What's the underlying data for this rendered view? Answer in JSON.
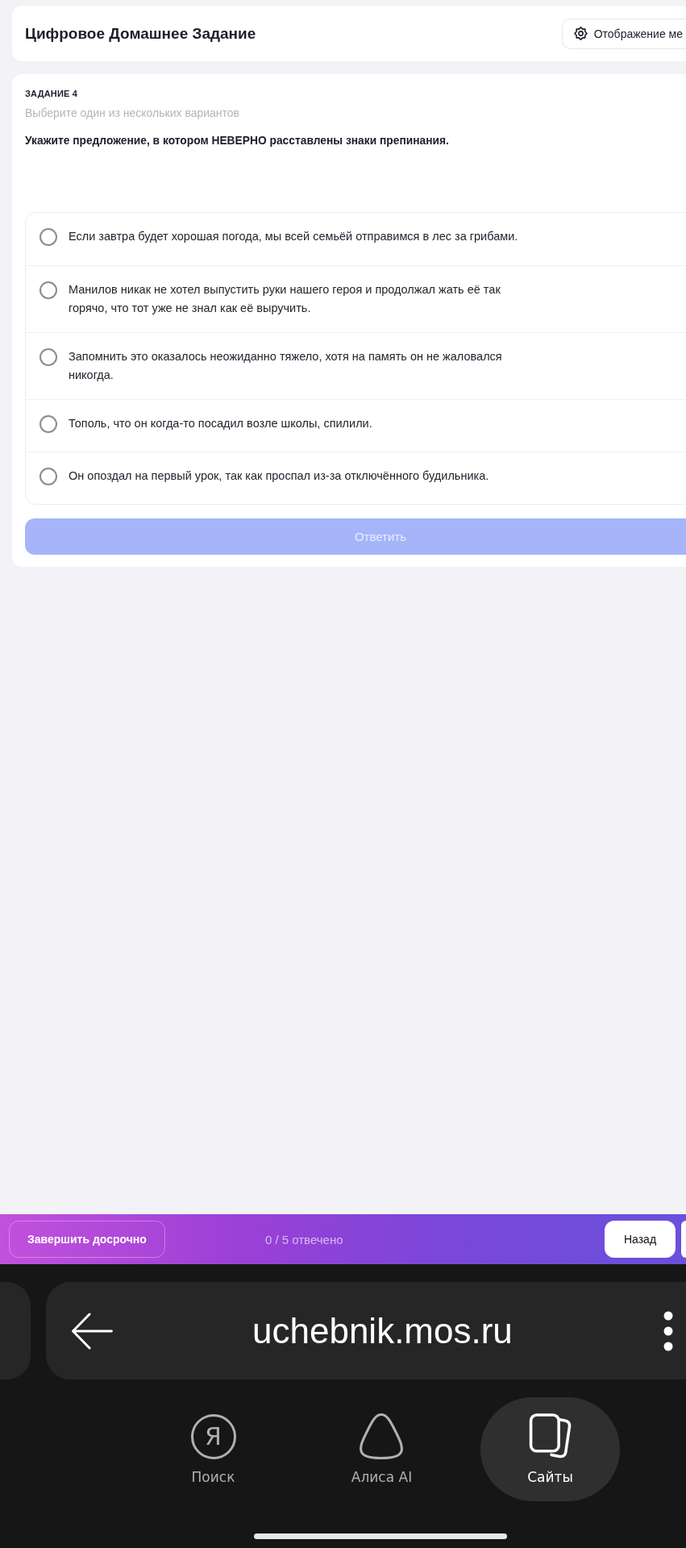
{
  "header": {
    "title": "Цифровое Домашнее Задание",
    "display_button": "Отображение ме"
  },
  "task": {
    "label": "ЗАДАНИЕ 4",
    "hint": "Выберите один из нескольких вариантов",
    "question": "Укажите предложение, в котором НЕВЕРНО расставлены знаки препинания.",
    "options": [
      {
        "text": "Если завтра будет хорошая погода, мы всей семьёй отправимся в лес за грибами.",
        "selected": false
      },
      {
        "text": "Манилов никак не хотел выпустить руки нашего героя и продолжал жать её так горячо, что тот уже не знал как её выручить.",
        "selected": false
      },
      {
        "text": "Запомнить это оказалось неожиданно тяжело, хотя на память он не жаловался никогда.",
        "selected": false
      },
      {
        "text": "Тополь, что он когда-то посадил возле школы, спилили.",
        "selected": false
      },
      {
        "text": "Он опоздал на первый урок, так как проспал из-за отключённого будильника.",
        "selected": false
      }
    ],
    "answer_button": {
      "label": "Ответить",
      "disabled": true
    }
  },
  "bottom_bar": {
    "finish_button": "Завершить досрочно",
    "progress": "0 / 5 отвечено",
    "back_button": "Назад"
  },
  "browser": {
    "url": "uchebnik.mos.ru",
    "nav": [
      {
        "kind": "search",
        "glyph": "Я",
        "label": "Поиск",
        "selected": false
      },
      {
        "kind": "assistant",
        "label": "Алиса AI",
        "selected": false
      },
      {
        "kind": "tabs",
        "label": "Сайты",
        "selected": true
      }
    ]
  }
}
